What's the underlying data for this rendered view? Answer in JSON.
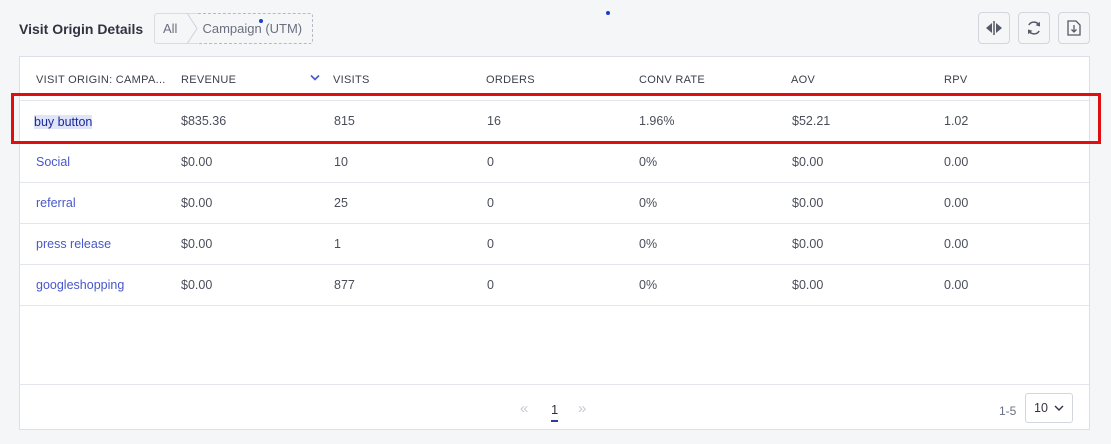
{
  "header": {
    "title": "Visit Origin Details",
    "breadcrumb": [
      "All",
      "Campaign (UTM)"
    ],
    "tools": [
      "split-view-icon",
      "refresh-icon",
      "download-icon"
    ]
  },
  "table": {
    "columns": [
      "VISIT ORIGIN: CAMPA...",
      "REVENUE",
      "VISITS",
      "ORDERS",
      "CONV RATE",
      "AOV",
      "RPV"
    ],
    "sorted_column": "VISITS",
    "rows": [
      {
        "origin": "buy button",
        "revenue": "$835.36",
        "visits": "815",
        "orders": "16",
        "conv_rate": "1.96%",
        "aov": "$52.21",
        "rpv": "1.02"
      },
      {
        "origin": "Social",
        "revenue": "$0.00",
        "visits": "10",
        "orders": "0",
        "conv_rate": "0%",
        "aov": "$0.00",
        "rpv": "0.00"
      },
      {
        "origin": "referral",
        "revenue": "$0.00",
        "visits": "25",
        "orders": "0",
        "conv_rate": "0%",
        "aov": "$0.00",
        "rpv": "0.00"
      },
      {
        "origin": "press release",
        "revenue": "$0.00",
        "visits": "1",
        "orders": "0",
        "conv_rate": "0%",
        "aov": "$0.00",
        "rpv": "0.00"
      },
      {
        "origin": "googleshopping",
        "revenue": "$0.00",
        "visits": "877",
        "orders": "0",
        "conv_rate": "0%",
        "aov": "$0.00",
        "rpv": "0.00"
      }
    ]
  },
  "pagination": {
    "prev": "«",
    "current_page": "1",
    "next": "»",
    "range": "1-5",
    "page_size": "10"
  },
  "colors": {
    "link": "#4858c9",
    "highlight_border": "#e00f0f",
    "active_page_underline": "#2a3aa8"
  }
}
